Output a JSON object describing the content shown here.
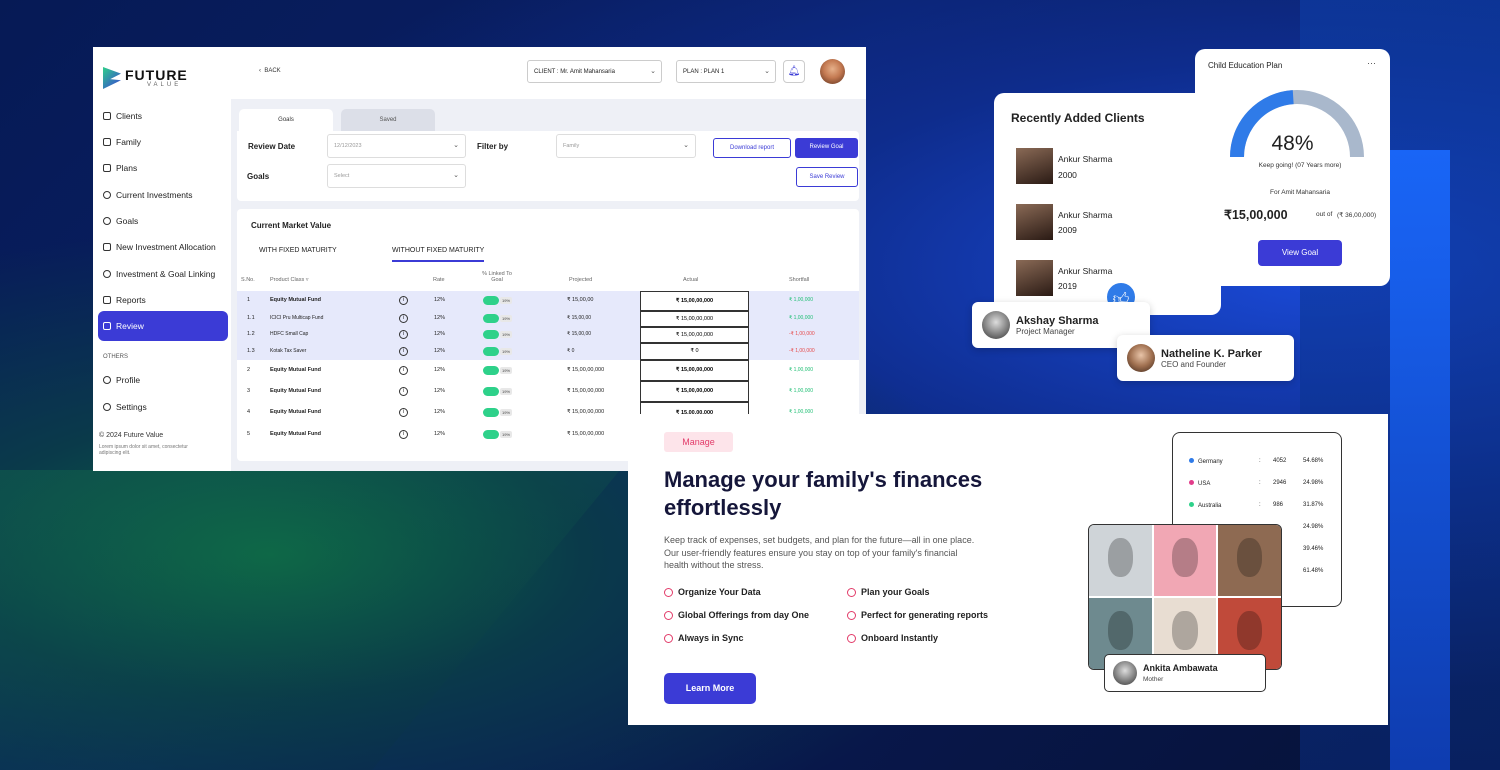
{
  "brand": {
    "name": "FUTURE",
    "tagline": "VALUE"
  },
  "sidebar": {
    "items": [
      {
        "label": "Clients"
      },
      {
        "label": "Family"
      },
      {
        "label": "Plans"
      },
      {
        "label": "Current Investments"
      },
      {
        "label": "Goals"
      },
      {
        "label": "New Investment Allocation"
      },
      {
        "label": "Investment & Goal Linking"
      },
      {
        "label": "Reports"
      },
      {
        "label": "Review"
      }
    ],
    "others_heading": "OTHERS",
    "others": [
      {
        "label": "Profile"
      },
      {
        "label": "Settings"
      }
    ],
    "copyright": "© 2024 Future Value",
    "lorem": "Lorem ipsum dolor sit amet, consectetur adipiscing elit."
  },
  "topbar": {
    "back": "BACK",
    "client_select": "CLIENT : Mr. Amit Mahansaria",
    "plan_select": "PLAN : PLAN 1"
  },
  "tabs": [
    {
      "label": "Goals"
    },
    {
      "label": "Saved"
    }
  ],
  "filters": {
    "review_date_label": "Review Date",
    "review_date_value": "12/12/2023",
    "filter_by_label": "Filter by",
    "filter_by_value": "Family",
    "goals_label": "Goals",
    "goals_value": "Select",
    "download": "Download report",
    "review_goal": "Review Goal",
    "save_review": "Save Review"
  },
  "table": {
    "title": "Current Market Value",
    "subtabs": [
      "WITH FIXED MATURITY",
      "WITHOUT FIXED MATURITY"
    ],
    "headers": [
      "S.No.",
      "Product Class",
      "Rate",
      "% Linked To Goal",
      "Projected",
      "Actual",
      "Shortfall"
    ],
    "rows": [
      {
        "sno": "1",
        "product": "Equity Mutual Fund",
        "rate": "12%",
        "linked": "19%",
        "projected": "₹ 15,00,00",
        "actual": "₹ 15,00,00,000",
        "shortfall": "₹ 1,00,000",
        "status": "green",
        "highlight": true,
        "sub": false
      },
      {
        "sno": "1.1",
        "product": "ICICI Pru Multicap Fund",
        "rate": "12%",
        "linked": "19%",
        "projected": "₹ 15,00,00",
        "actual": "₹ 15,00,00,000",
        "shortfall": "₹ 1,00,000",
        "status": "green",
        "highlight": true,
        "sub": true
      },
      {
        "sno": "1.2",
        "product": "HDFC Small Cap",
        "rate": "12%",
        "linked": "19%",
        "projected": "₹ 15,00,00",
        "actual": "₹ 15,00,00,000",
        "shortfall": "-₹ 1,00,000",
        "status": "red",
        "highlight": true,
        "sub": true
      },
      {
        "sno": "1.3",
        "product": "Kotak Tax Saver",
        "rate": "12%",
        "linked": "19%",
        "projected": "₹ 0",
        "actual": "₹ 0",
        "shortfall": "-₹ 1,00,000",
        "status": "red",
        "highlight": true,
        "sub": true
      },
      {
        "sno": "2",
        "product": "Equity Mutual Fund",
        "rate": "12%",
        "linked": "19%",
        "projected": "₹ 15,00,00,000",
        "actual": "₹ 15,00,00,000",
        "shortfall": "₹ 1,00,000",
        "status": "green",
        "highlight": false,
        "sub": false
      },
      {
        "sno": "3",
        "product": "Equity Mutual Fund",
        "rate": "12%",
        "linked": "19%",
        "projected": "₹ 15,00,00,000",
        "actual": "₹ 15,00,00,000",
        "shortfall": "₹ 1,00,000",
        "status": "green",
        "highlight": false,
        "sub": false
      },
      {
        "sno": "4",
        "product": "Equity Mutual Fund",
        "rate": "12%",
        "linked": "19%",
        "projected": "₹ 15,00,00,000",
        "actual": "₹ 15,00,00,000",
        "shortfall": "₹ 1,00,000",
        "status": "green",
        "highlight": false,
        "sub": false
      },
      {
        "sno": "5",
        "product": "Equity Mutual Fund",
        "rate": "12%",
        "linked": "19%",
        "projected": "₹ 15,00,00,000",
        "actual": "",
        "shortfall": "",
        "status": "green",
        "highlight": false,
        "sub": false
      }
    ]
  },
  "clients_card": {
    "title": "Recently Added Clients",
    "clients": [
      {
        "name": "Ankur Sharma",
        "year": "2000"
      },
      {
        "name": "Ankur Sharma",
        "year": "2009"
      },
      {
        "name": "Ankur Sharma",
        "year": "2019"
      }
    ]
  },
  "people": {
    "akshay": {
      "name": "Akshay Sharma",
      "role": "Project Manager"
    },
    "natheline": {
      "name": "Natheline K. Parker",
      "role": "CEO and Founder"
    },
    "ankita": {
      "name": "Ankita Ambawata",
      "role": "Mother"
    }
  },
  "child_plan": {
    "title": "Child Education Plan",
    "menu": "···",
    "percent": "48%",
    "progress": 0.48,
    "message": "Keep going! (07 Years more)",
    "for": "For Amit Mahansaria",
    "amount": "₹15,00,000",
    "out_of": "out of",
    "total": "(₹ 36,00,000)",
    "button": "View Goal"
  },
  "manage": {
    "badge": "Manage",
    "headline": "Manage your family's finances effortlessly",
    "paragraph": "Keep track of expenses, set budgets, and plan for the future—all in one place. Our user-friendly features ensure you stay on top of your family's financial health without the stress.",
    "features": [
      "Organize Your Data",
      "Plan your Goals",
      "Global Offerings from day One",
      "Perfect for generating reports",
      "Always in Sync",
      "Onboard Instantly"
    ],
    "button": "Learn More"
  },
  "stats": [
    {
      "country": "Germany",
      "sep": ":",
      "count": "4052",
      "pct": "54.68%",
      "color": "#2f7be8"
    },
    {
      "country": "USA",
      "sep": ":",
      "count": "2946",
      "pct": "24.98%",
      "color": "#e23c8a"
    },
    {
      "country": "Australia",
      "sep": ":",
      "count": "986",
      "pct": "31.87%",
      "color": "#2ed18a"
    },
    {
      "pct": "24.98%"
    },
    {
      "pct": "39.46%"
    },
    {
      "pct": "61.48%"
    }
  ],
  "colors": {
    "accent": "#3b3bd6",
    "green": "#1fbf74",
    "red": "#e64a4a",
    "pink": "#e23c6a"
  }
}
